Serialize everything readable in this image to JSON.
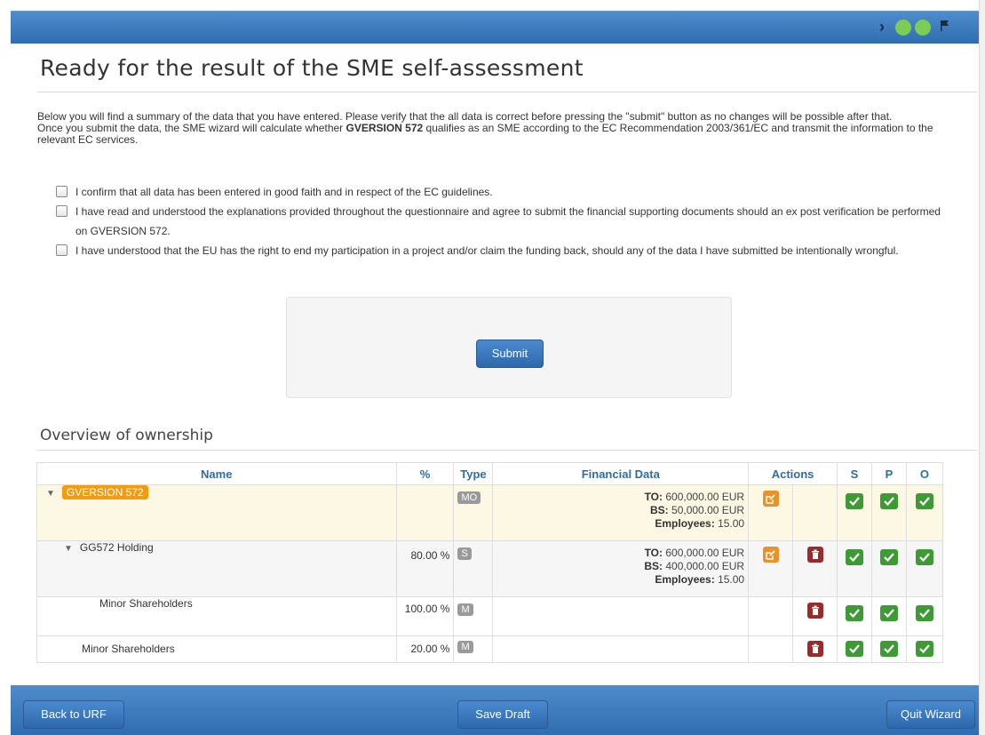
{
  "header": {
    "step_dots": [
      "#7ccd55",
      "#7ccd55"
    ],
    "chevron_icon": "chevron-right-icon",
    "flag_icon": "flag-icon"
  },
  "page": {
    "title": "Ready for the result of the SME self-assessment",
    "intro_1": "Below you will find a summary of the data that you have entered. Please verify that the all data is correct before pressing the \"submit\" button as no changes will be possible after that.",
    "intro_2_pre": "Once you submit the data, the SME wizard will calculate whether ",
    "intro_2_company": "GVERSION 572",
    "intro_2_post": " qualifies as an SME according to the EC Recommendation 2003/361/EC and transmit the information to the relevant EC services."
  },
  "confirmations": [
    {
      "label": "I confirm that all data has been entered in good faith and in respect of the EC guidelines.",
      "checked": false
    },
    {
      "label": "I have read and understood the explanations provided throughout the questionnaire and agree to submit the financial supporting documents should an ex post verification be performed on GVERSION 572.",
      "checked": false
    },
    {
      "label": "I have understood that the EU has the right to end my participation in a project and/or claim the funding back, should any of the data I have submitted be intentionally wrongful.",
      "checked": false
    }
  ],
  "submit_label": "Submit",
  "ownership": {
    "title": "Overview of ownership",
    "columns": {
      "name": "Name",
      "pct": "%",
      "type": "Type",
      "fin": "Financial Data",
      "actions": "Actions",
      "s": "S",
      "p": "P",
      "o": "O"
    },
    "rows": [
      {
        "name": "GVERSION 572",
        "pct": "",
        "type": "MO",
        "to": "600,000.00 EUR",
        "bs": "50,000.00 EUR",
        "employees": "15.00"
      },
      {
        "name": "GG572 Holding",
        "pct": "80.00 %",
        "type": "S",
        "to": "600,000.00 EUR",
        "bs": "400,000.00 EUR",
        "employees": "15.00"
      },
      {
        "name": "Minor Shareholders",
        "pct": "100.00 %",
        "type": "M"
      },
      {
        "name": "Minor Shareholders",
        "pct": "20.00 %",
        "type": "M"
      }
    ],
    "fin_labels": {
      "to": "TO:",
      "bs": "BS:",
      "employees": "Employees:"
    }
  },
  "footer": {
    "back": "Back to URF",
    "save": "Save Draft",
    "quit": "Quit Wizard"
  },
  "colors": {
    "brand_blue": "#2f6db0",
    "ok_green": "#3e9a35",
    "edit_orange": "#e8922a",
    "delete_red": "#9b2a2a",
    "highlight_row": "#fcf8e3"
  }
}
